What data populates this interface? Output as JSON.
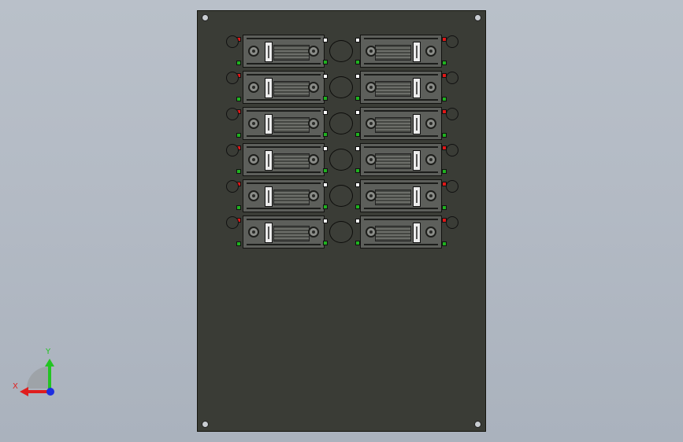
{
  "viewport": {
    "background_top": "#b9c0c9",
    "background_bottom": "#aab2bd"
  },
  "panel": {
    "color": "#3a3c36",
    "relays_per_column": 6,
    "columns": 2,
    "terminal_colors": {
      "red": "#e01818",
      "green": "#1fb21f",
      "white": "#ffffff"
    }
  },
  "triad": {
    "x_label": "X",
    "y_label": "Y",
    "x_color": "#e01e1e",
    "y_color": "#23c423",
    "z_color": "#1e2ee0"
  }
}
